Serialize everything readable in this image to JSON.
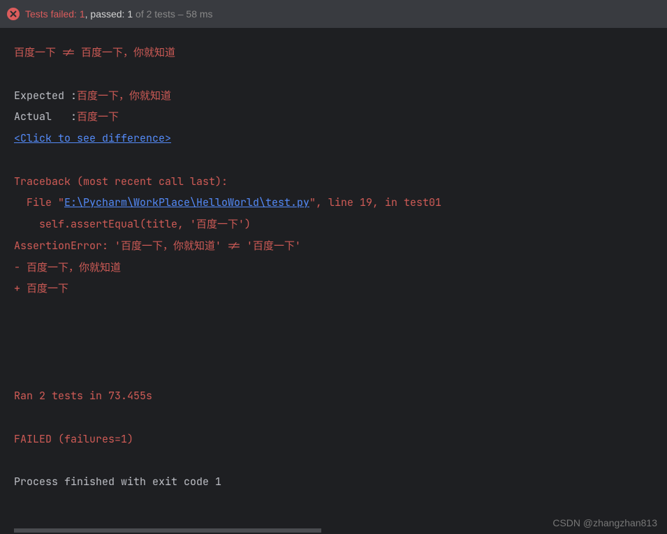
{
  "header": {
    "failed_label": "Tests failed:",
    "failed_count": "1",
    "passed_label": ", passed:",
    "passed_count": "1",
    "total_text": " of 2 tests – 58 ms"
  },
  "console": {
    "neq_line": "百度一下 != 百度一下，你就知道",
    "expected_label": "Expected :",
    "expected_value": "百度一下，你就知道",
    "actual_label": "Actual   :",
    "actual_value": "百度一下",
    "diff_link": "<Click to see difference>",
    "traceback_header": "Traceback (most recent call last):",
    "file_prefix": "  File \"",
    "file_path": "E:\\Pycharm\\WorkPlace\\HelloWorld\\test.py",
    "file_suffix": "\", line 19, in test01",
    "code_line": "    self.assertEqual(title, '百度一下')",
    "assertion_error": "AssertionError: '百度一下，你就知道' != '百度一下'",
    "diff_minus": "- 百度一下，你就知道",
    "diff_plus": "+ 百度一下",
    "ran_line": "Ran 2 tests in 73.455s",
    "failed_line": "FAILED (failures=1)",
    "exit_line": "Process finished with exit code 1"
  },
  "watermark": "CSDN @zhangzhan813"
}
